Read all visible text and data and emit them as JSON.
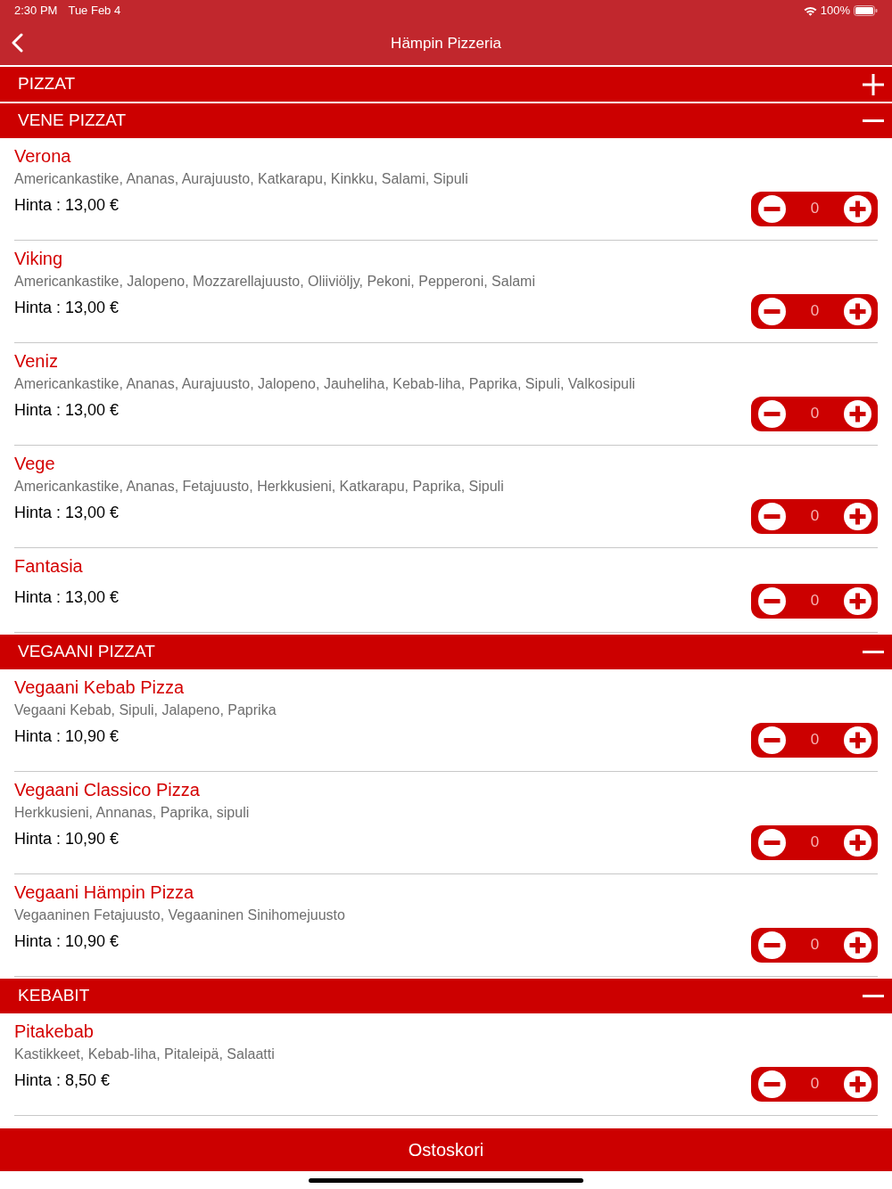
{
  "status_bar": {
    "time": "2:30 PM",
    "date": "Tue Feb 4",
    "battery": "100%"
  },
  "nav": {
    "title": "Hämpin Pizzeria"
  },
  "sections": [
    {
      "title": "PIZZAT",
      "expanded": false
    },
    {
      "title": "VENE PIZZAT",
      "expanded": true,
      "items": [
        {
          "name": "Verona",
          "description": "Americankastike, Ananas, Aurajuusto, Katkarapu, Kinkku, Salami, Sipuli",
          "price": "Hinta : 13,00 €",
          "quantity": "0"
        },
        {
          "name": "Viking",
          "description": "Americankastike, Jalopeno, Mozzarellajuusto, Oliiviöljy, Pekoni, Pepperoni, Salami",
          "price": "Hinta : 13,00 €",
          "quantity": "0"
        },
        {
          "name": "Veniz",
          "description": "Americankastike, Ananas, Aurajuusto, Jalopeno, Jauheliha, Kebab-liha, Paprika, Sipuli, Valkosipuli",
          "price": "Hinta : 13,00 €",
          "quantity": "0"
        },
        {
          "name": "Vege",
          "description": "Americankastike, Ananas, Fetajuusto, Herkkusieni, Katkarapu, Paprika, Sipuli",
          "price": "Hinta : 13,00 €",
          "quantity": "0"
        },
        {
          "name": "Fantasia",
          "price": "Hinta : 13,00 €",
          "quantity": "0"
        }
      ]
    },
    {
      "title": "VEGAANI PIZZAT",
      "expanded": true,
      "items": [
        {
          "name": "Vegaani Kebab Pizza",
          "description": "Vegaani Kebab, Sipuli, Jalapeno, Paprika",
          "price": "Hinta : 10,90 €",
          "quantity": "0"
        },
        {
          "name": "Vegaani Classico Pizza",
          "description": "Herkkusieni, Annanas, Paprika, sipuli",
          "price": "Hinta : 10,90 €",
          "quantity": "0"
        },
        {
          "name": "Vegaani Hämpin Pizza",
          "description": "Vegaaninen Fetajuusto, Vegaaninen Sinihomejuusto",
          "price": "Hinta : 10,90 €",
          "quantity": "0"
        }
      ]
    },
    {
      "title": "KEBABIT",
      "expanded": true,
      "items": [
        {
          "name": "Pitakebab",
          "description": "Kastikkeet, Kebab-liha, Pitaleipä, Salaatti",
          "price": "Hinta : 8,50 €",
          "quantity": "0"
        }
      ]
    }
  ],
  "cart_button": "Ostoskori"
}
